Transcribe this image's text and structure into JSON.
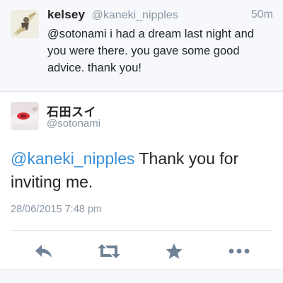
{
  "reply_tweet": {
    "name": "kelsey",
    "handle": "@kaneki_nipples",
    "time": "50m",
    "text": "@sotonami i had a dream last night and you were there. you gave some good advice. thank you!",
    "avatar_icon": "illustrated-avatar-icon"
  },
  "main_tweet": {
    "name": "石田スイ",
    "handle": "@sotonami",
    "mention": "@kaneki_nipples",
    "text_after_mention": " Thank you for inviting me.",
    "timestamp": "28/06/2015 7:48 pm",
    "avatar_icon": "illustrated-avatar-icon"
  },
  "actions": [
    {
      "name": "reply-icon"
    },
    {
      "name": "retweet-icon"
    },
    {
      "name": "favorite-star-icon"
    },
    {
      "name": "more-icon"
    }
  ],
  "colors": {
    "link": "#3a8fd9",
    "muted": "#8b98a5",
    "icon": "#6f8296",
    "text": "#1f2326"
  }
}
